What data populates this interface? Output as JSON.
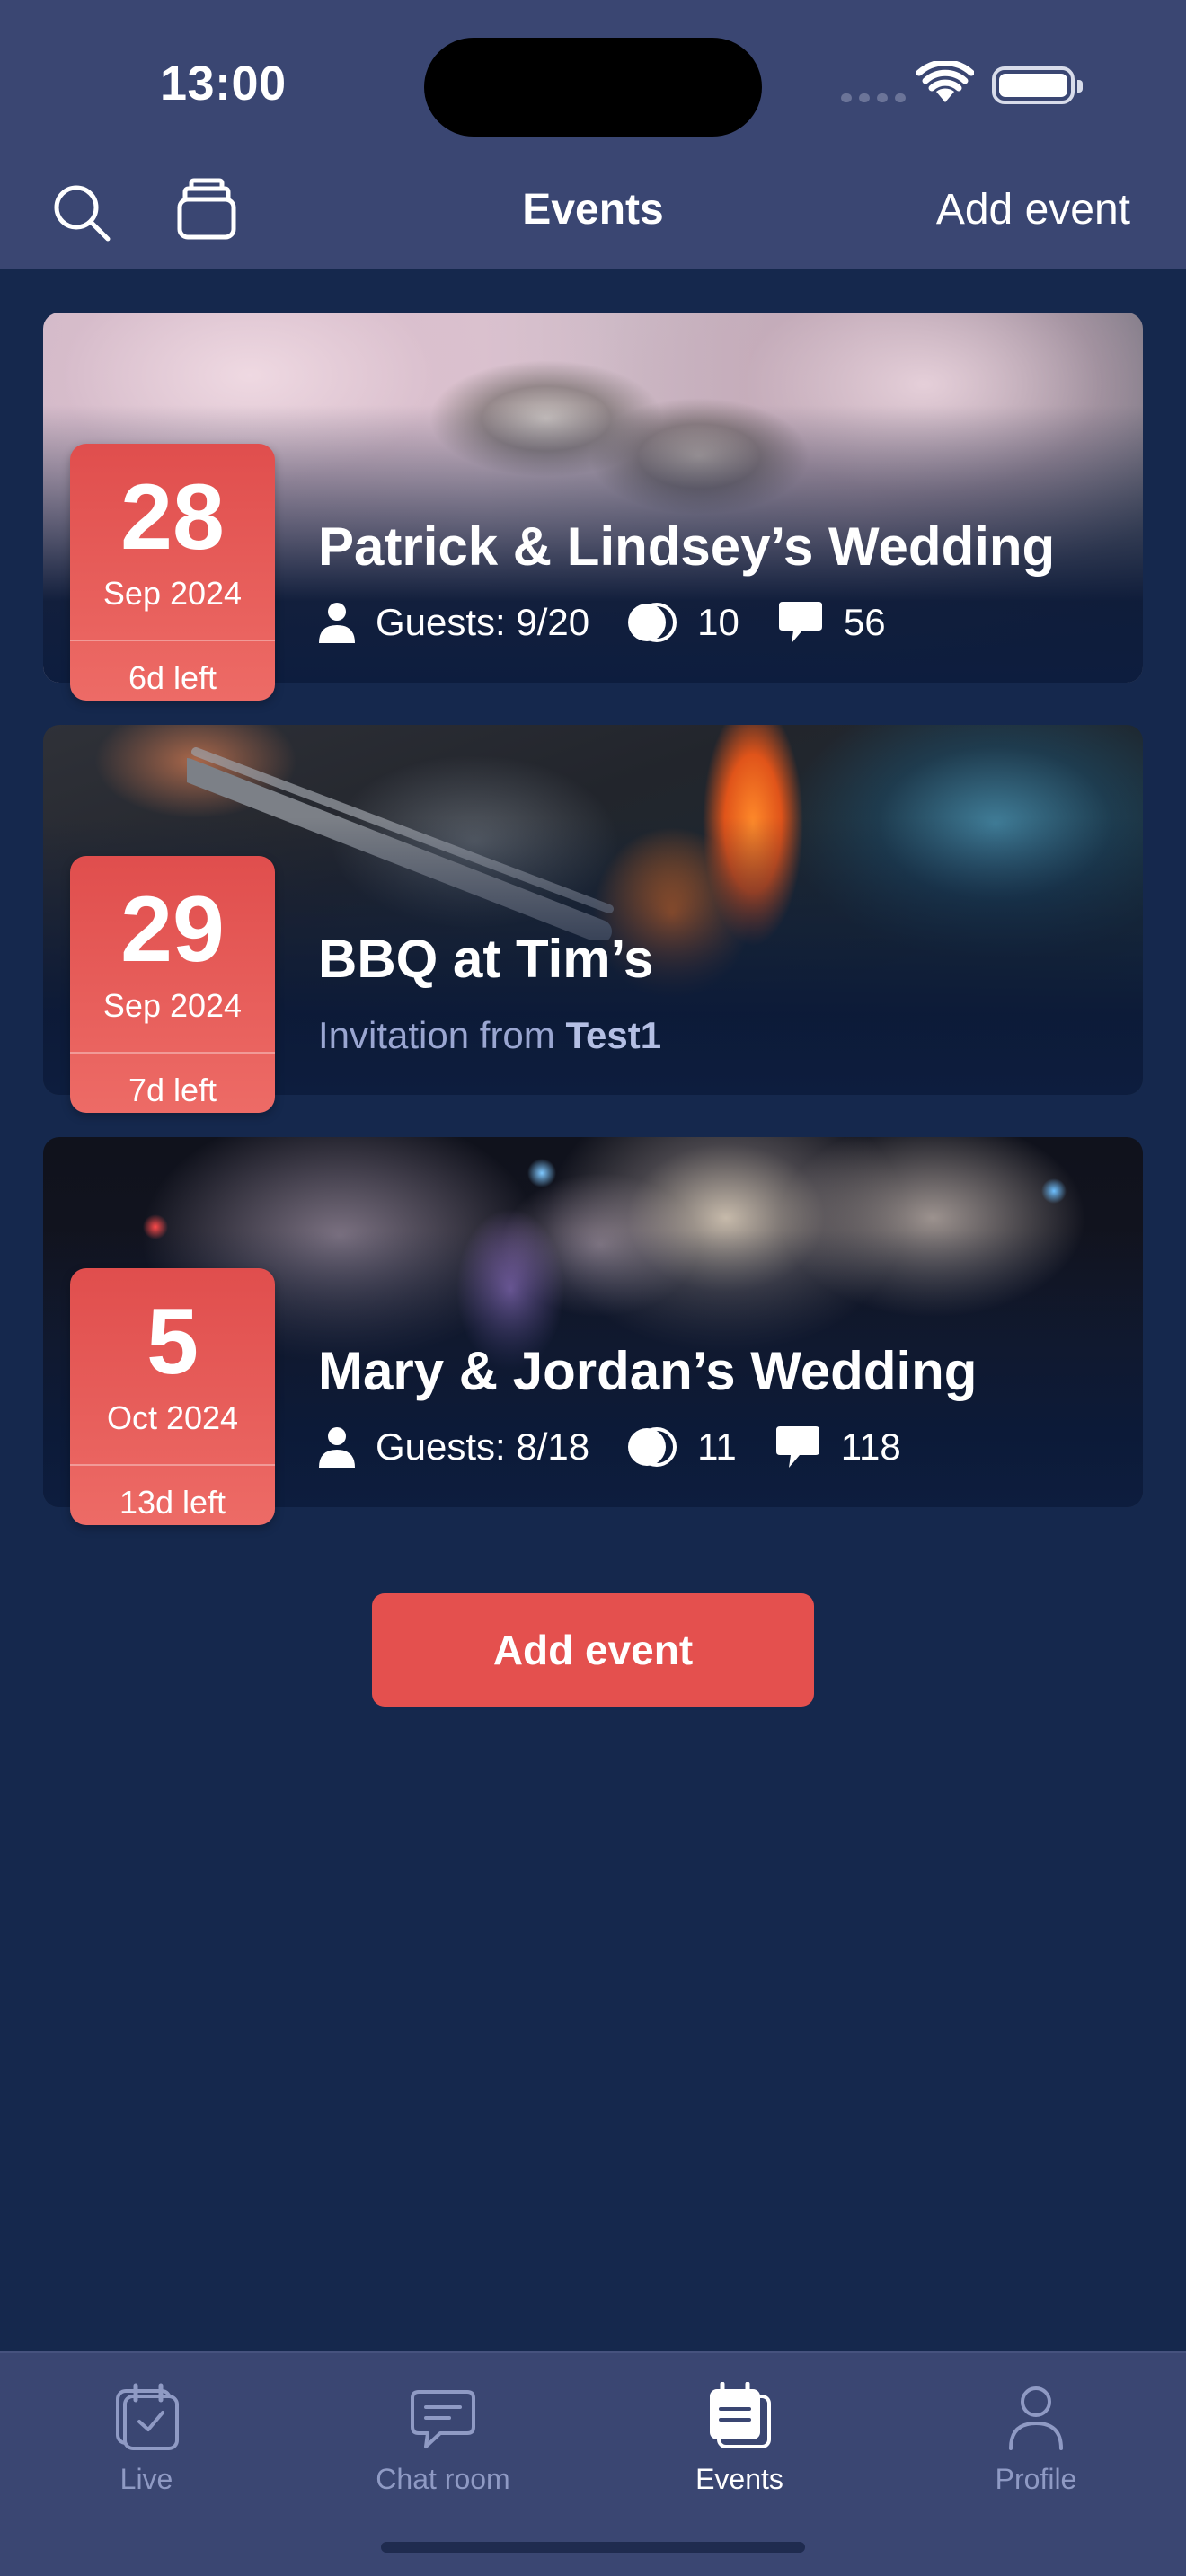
{
  "status_bar": {
    "time": "13:00"
  },
  "nav": {
    "title": "Events",
    "add_event_label": "Add event"
  },
  "events": [
    {
      "title": "Patrick & Lindsey’s Wedding",
      "day": "28",
      "month_year": "Sep 2024",
      "days_left": "6d left",
      "guests": "Guests: 9/20",
      "rsvp_count": "10",
      "comment_count": "56"
    },
    {
      "title": "BBQ at Tim’s",
      "day": "29",
      "month_year": "Sep 2024",
      "days_left": "7d left",
      "invitation_prefix": "Invitation from",
      "invitation_from": "Test1"
    },
    {
      "title": "Mary & Jordan’s Wedding",
      "day": "5",
      "month_year": "Oct 2024",
      "days_left": "13d left",
      "guests": "Guests: 8/18",
      "rsvp_count": "11",
      "comment_count": "118"
    }
  ],
  "add_event_button": "Add event",
  "tabs": [
    {
      "label": "Live",
      "icon": "calendar-check-icon"
    },
    {
      "label": "Chat room",
      "icon": "chat-bubble-icon"
    },
    {
      "label": "Events",
      "icon": "events-icon",
      "active": true
    },
    {
      "label": "Profile",
      "icon": "person-icon"
    }
  ],
  "colors": {
    "background": "#15284d",
    "bars": "#3a4672",
    "accent": "#e4504e",
    "inactive_tab": "#8f9ac4"
  }
}
